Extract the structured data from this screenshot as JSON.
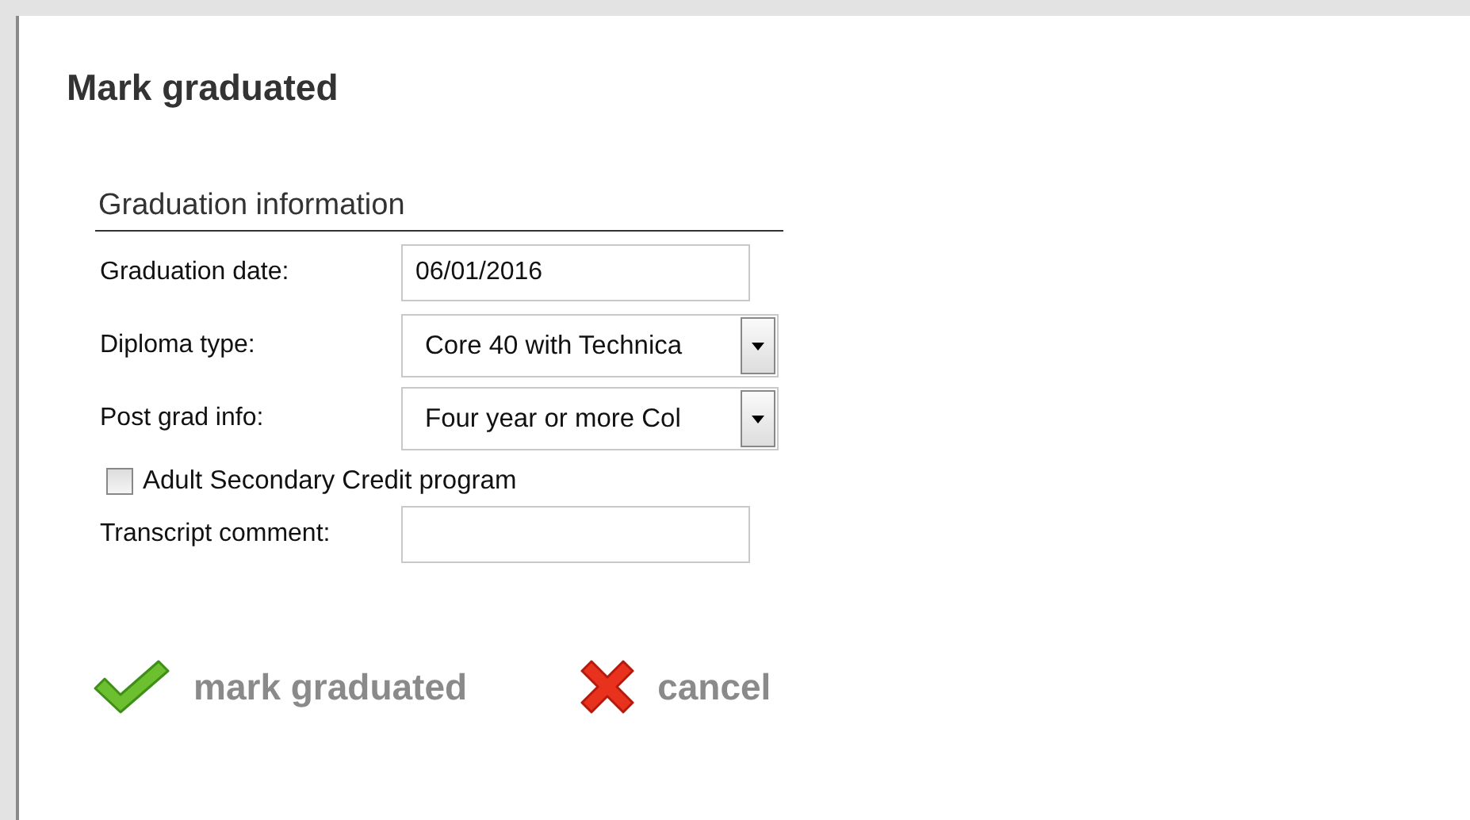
{
  "dialog": {
    "title": "Mark graduated"
  },
  "section": {
    "title": "Graduation information"
  },
  "fields": [
    {
      "kind": "text",
      "label": "Graduation date:",
      "value": "06/01/2016"
    },
    {
      "kind": "select",
      "label": "Diploma type:",
      "value": "Core 40 with Technica"
    },
    {
      "kind": "select",
      "label": "Post grad info:",
      "value": "Four year or more Col"
    },
    {
      "kind": "checkbox",
      "label": "Adult Secondary Credit program",
      "checked": false
    },
    {
      "kind": "text",
      "label": "Transcript comment:"
    }
  ],
  "actions": [
    {
      "kind": "confirm",
      "label": "mark graduated"
    },
    {
      "kind": "cancel",
      "label": "cancel"
    }
  ]
}
